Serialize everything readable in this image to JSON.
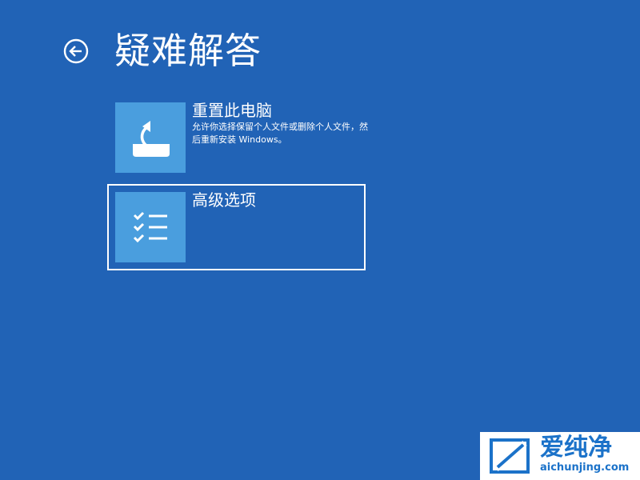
{
  "page": {
    "title": "疑难解答",
    "background_color": "#2163b6",
    "tile_color": "#4a9ede"
  },
  "back": {
    "icon": "back-arrow-icon"
  },
  "options": [
    {
      "title": "重置此电脑",
      "description": "允许你选择保留个人文件或删除个人文件，然后重新安装 Windows。",
      "icon": "reset-pc-icon"
    },
    {
      "title": "高级选项",
      "description": "",
      "icon": "checklist-icon",
      "selected": true
    }
  ],
  "watermark": {
    "name": "爱纯净",
    "url": "aichunjing.com",
    "color": "#1b72c9"
  }
}
